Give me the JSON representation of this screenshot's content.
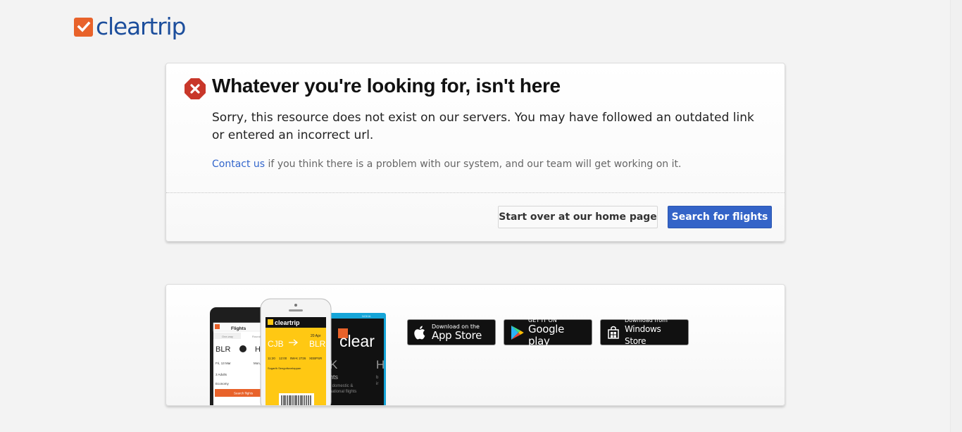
{
  "brand": {
    "name": "cleartrip",
    "color": "#1c4e9c",
    "accent": "#e8622a"
  },
  "error": {
    "title": "Whatever you're looking for, isn't here",
    "message": "Sorry, this resource does not exist on our servers. You may have followed an outdated link or entered an incorrect url.",
    "contact_link": "Contact us",
    "contact_rest": " if you think there is a problem with our system, and our team will get working on it.",
    "icon": "error-stop-icon"
  },
  "actions": {
    "home_label": "Start over at our home page",
    "flights_label": "Search for flights"
  },
  "app_promo": {
    "phone_yellow": {
      "brand": "cleartrip",
      "from_code": "CJB",
      "to_code": "BLR",
      "date": "20 Apr",
      "times": [
        "11:20",
        "12:00"
      ],
      "flight": "9W-K 2726",
      "pnr": "XEBPSR",
      "passenger": "Sugarth Sengottuvelappan"
    },
    "phone_left": {
      "title": "Flights",
      "tabs": [
        "One-way",
        "Round"
      ],
      "from_code": "BLR",
      "to_code": "H",
      "date": "Fri, 13 Mar",
      "return": "Mon,",
      "travellers": "3 Adults",
      "class": "Economy",
      "search_btn": "Search flights"
    },
    "phone_right": {
      "brand": "clear",
      "letter_left": "K",
      "letter_right": "H",
      "line1": "hts",
      "line2": "r domestic &",
      "line3": "national flights",
      "side1": "b",
      "side2": "ir",
      "carrier": "NOKIA"
    },
    "badges": [
      {
        "top": "Download on the",
        "bottom": "App Store",
        "icon": "apple-icon"
      },
      {
        "top": "GET IT ON",
        "bottom": "Google play",
        "icon": "google-play-icon"
      },
      {
        "top": "Download from",
        "bottom": "Windows Store",
        "icon": "windows-icon"
      }
    ]
  }
}
